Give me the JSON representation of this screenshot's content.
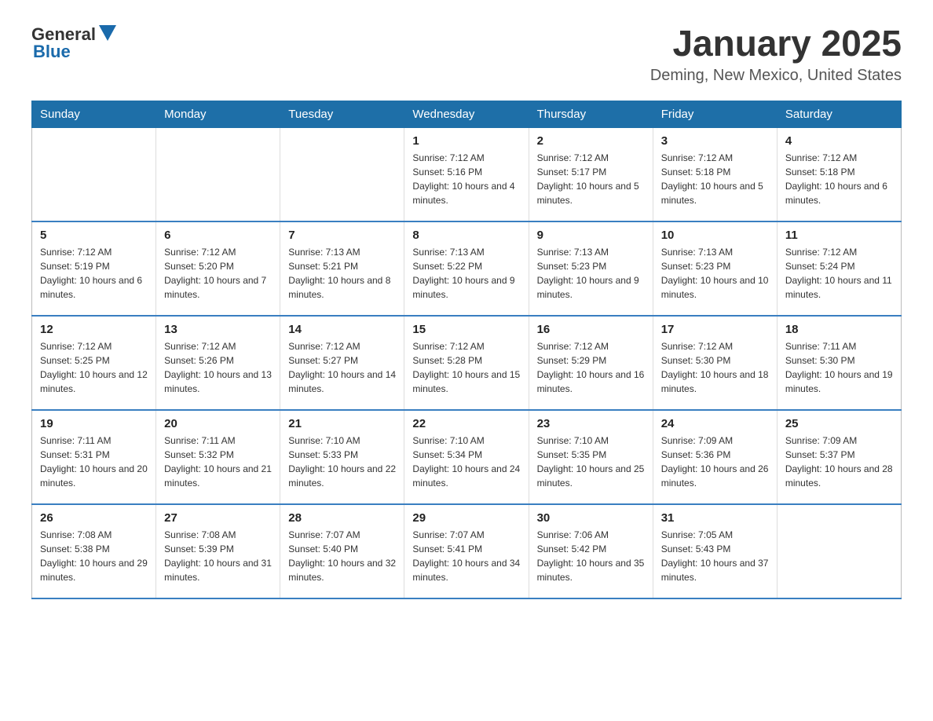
{
  "header": {
    "logo_general": "General",
    "logo_blue": "Blue",
    "title": "January 2025",
    "subtitle": "Deming, New Mexico, United States"
  },
  "days_of_week": [
    "Sunday",
    "Monday",
    "Tuesday",
    "Wednesday",
    "Thursday",
    "Friday",
    "Saturday"
  ],
  "weeks": [
    [
      {
        "day": "",
        "info": ""
      },
      {
        "day": "",
        "info": ""
      },
      {
        "day": "",
        "info": ""
      },
      {
        "day": "1",
        "info": "Sunrise: 7:12 AM\nSunset: 5:16 PM\nDaylight: 10 hours and 4 minutes."
      },
      {
        "day": "2",
        "info": "Sunrise: 7:12 AM\nSunset: 5:17 PM\nDaylight: 10 hours and 5 minutes."
      },
      {
        "day": "3",
        "info": "Sunrise: 7:12 AM\nSunset: 5:18 PM\nDaylight: 10 hours and 5 minutes."
      },
      {
        "day": "4",
        "info": "Sunrise: 7:12 AM\nSunset: 5:18 PM\nDaylight: 10 hours and 6 minutes."
      }
    ],
    [
      {
        "day": "5",
        "info": "Sunrise: 7:12 AM\nSunset: 5:19 PM\nDaylight: 10 hours and 6 minutes."
      },
      {
        "day": "6",
        "info": "Sunrise: 7:12 AM\nSunset: 5:20 PM\nDaylight: 10 hours and 7 minutes."
      },
      {
        "day": "7",
        "info": "Sunrise: 7:13 AM\nSunset: 5:21 PM\nDaylight: 10 hours and 8 minutes."
      },
      {
        "day": "8",
        "info": "Sunrise: 7:13 AM\nSunset: 5:22 PM\nDaylight: 10 hours and 9 minutes."
      },
      {
        "day": "9",
        "info": "Sunrise: 7:13 AM\nSunset: 5:23 PM\nDaylight: 10 hours and 9 minutes."
      },
      {
        "day": "10",
        "info": "Sunrise: 7:13 AM\nSunset: 5:23 PM\nDaylight: 10 hours and 10 minutes."
      },
      {
        "day": "11",
        "info": "Sunrise: 7:12 AM\nSunset: 5:24 PM\nDaylight: 10 hours and 11 minutes."
      }
    ],
    [
      {
        "day": "12",
        "info": "Sunrise: 7:12 AM\nSunset: 5:25 PM\nDaylight: 10 hours and 12 minutes."
      },
      {
        "day": "13",
        "info": "Sunrise: 7:12 AM\nSunset: 5:26 PM\nDaylight: 10 hours and 13 minutes."
      },
      {
        "day": "14",
        "info": "Sunrise: 7:12 AM\nSunset: 5:27 PM\nDaylight: 10 hours and 14 minutes."
      },
      {
        "day": "15",
        "info": "Sunrise: 7:12 AM\nSunset: 5:28 PM\nDaylight: 10 hours and 15 minutes."
      },
      {
        "day": "16",
        "info": "Sunrise: 7:12 AM\nSunset: 5:29 PM\nDaylight: 10 hours and 16 minutes."
      },
      {
        "day": "17",
        "info": "Sunrise: 7:12 AM\nSunset: 5:30 PM\nDaylight: 10 hours and 18 minutes."
      },
      {
        "day": "18",
        "info": "Sunrise: 7:11 AM\nSunset: 5:30 PM\nDaylight: 10 hours and 19 minutes."
      }
    ],
    [
      {
        "day": "19",
        "info": "Sunrise: 7:11 AM\nSunset: 5:31 PM\nDaylight: 10 hours and 20 minutes."
      },
      {
        "day": "20",
        "info": "Sunrise: 7:11 AM\nSunset: 5:32 PM\nDaylight: 10 hours and 21 minutes."
      },
      {
        "day": "21",
        "info": "Sunrise: 7:10 AM\nSunset: 5:33 PM\nDaylight: 10 hours and 22 minutes."
      },
      {
        "day": "22",
        "info": "Sunrise: 7:10 AM\nSunset: 5:34 PM\nDaylight: 10 hours and 24 minutes."
      },
      {
        "day": "23",
        "info": "Sunrise: 7:10 AM\nSunset: 5:35 PM\nDaylight: 10 hours and 25 minutes."
      },
      {
        "day": "24",
        "info": "Sunrise: 7:09 AM\nSunset: 5:36 PM\nDaylight: 10 hours and 26 minutes."
      },
      {
        "day": "25",
        "info": "Sunrise: 7:09 AM\nSunset: 5:37 PM\nDaylight: 10 hours and 28 minutes."
      }
    ],
    [
      {
        "day": "26",
        "info": "Sunrise: 7:08 AM\nSunset: 5:38 PM\nDaylight: 10 hours and 29 minutes."
      },
      {
        "day": "27",
        "info": "Sunrise: 7:08 AM\nSunset: 5:39 PM\nDaylight: 10 hours and 31 minutes."
      },
      {
        "day": "28",
        "info": "Sunrise: 7:07 AM\nSunset: 5:40 PM\nDaylight: 10 hours and 32 minutes."
      },
      {
        "day": "29",
        "info": "Sunrise: 7:07 AM\nSunset: 5:41 PM\nDaylight: 10 hours and 34 minutes."
      },
      {
        "day": "30",
        "info": "Sunrise: 7:06 AM\nSunset: 5:42 PM\nDaylight: 10 hours and 35 minutes."
      },
      {
        "day": "31",
        "info": "Sunrise: 7:05 AM\nSunset: 5:43 PM\nDaylight: 10 hours and 37 minutes."
      },
      {
        "day": "",
        "info": ""
      }
    ]
  ]
}
